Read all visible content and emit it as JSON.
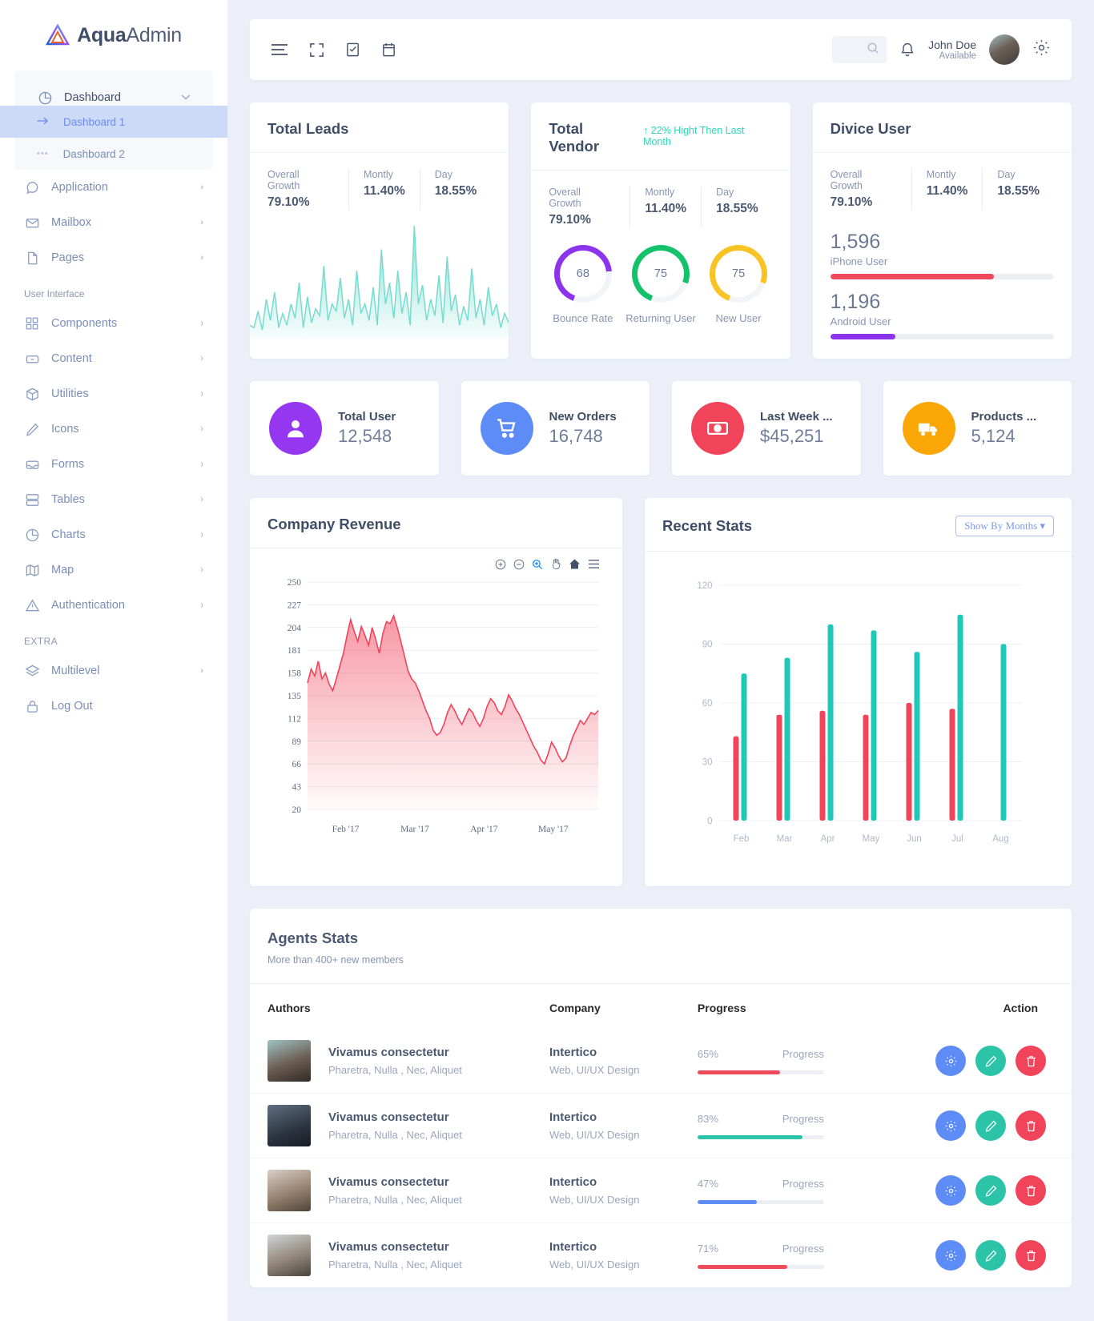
{
  "brand": {
    "strong": "Aqua",
    "light": "Admin",
    "logo_icon": "triangle-logo-icon"
  },
  "sidebar": {
    "dashboard": {
      "label": "Dashboard",
      "icon": "pie-chart-icon",
      "chevron": "chevron-down-icon"
    },
    "sub_items": [
      {
        "label": "Dashboard 1",
        "icon": "arrow-right-icon",
        "active": true
      },
      {
        "label": "Dashboard 2",
        "icon": "dots-icon",
        "active": false
      }
    ],
    "items": [
      {
        "label": "Application",
        "icon": "chat-bubble-icon"
      },
      {
        "label": "Mailbox",
        "icon": "envelope-icon"
      },
      {
        "label": "Pages",
        "icon": "file-icon"
      }
    ],
    "caption_ui": "User Interface",
    "ui_items": [
      {
        "label": "Components",
        "icon": "grid-icon"
      },
      {
        "label": "Content",
        "icon": "drawer-icon"
      },
      {
        "label": "Utilities",
        "icon": "box-icon"
      },
      {
        "label": "Icons",
        "icon": "pencil-icon"
      },
      {
        "label": "Forms",
        "icon": "inbox-icon"
      },
      {
        "label": "Tables",
        "icon": "table-icon"
      },
      {
        "label": "Charts",
        "icon": "pie-chart-icon"
      },
      {
        "label": "Map",
        "icon": "map-icon"
      },
      {
        "label": "Authentication",
        "icon": "warning-triangle-icon"
      }
    ],
    "caption_extra": "EXTRA",
    "extra_items": [
      {
        "label": "Multilevel",
        "icon": "layers-icon",
        "chevron": true
      },
      {
        "label": "Log Out",
        "icon": "lock-icon",
        "chevron": false
      }
    ]
  },
  "topbar": {
    "menu_icon": "hamburger-menu-icon",
    "fullscreen_icon": "fullscreen-icon",
    "task_icon": "checklist-icon",
    "calendar_icon": "calendar-icon",
    "search_placeholder": "",
    "search_icon": "search-icon",
    "bell_icon": "bell-icon",
    "user_name": "John Doe",
    "user_status": "Available",
    "settings_icon": "gear-icon"
  },
  "cards": {
    "total_leads": {
      "title": "Total Leads",
      "metrics": [
        {
          "label": "Overall Growth",
          "value": "79.10%"
        },
        {
          "label": "Montly",
          "value": "11.40%"
        },
        {
          "label": "Day",
          "value": "18.55%"
        }
      ]
    },
    "total_vendor": {
      "title": "Total Vendor",
      "badge": "22% Hight Then Last Month",
      "badge_icon": "arrow-up-icon",
      "badge_color": "#2cd5b5",
      "metrics": [
        {
          "label": "Overall Growth",
          "value": "79.10%"
        },
        {
          "label": "Montly",
          "value": "11.40%"
        },
        {
          "label": "Day",
          "value": "18.55%"
        }
      ],
      "donuts": [
        {
          "value": "68",
          "label": "Bounce Rate",
          "color": "#8c34eb",
          "pct": 68
        },
        {
          "value": "75",
          "label": "Returning User",
          "color": "#13c26b",
          "pct": 75
        },
        {
          "value": "75",
          "label": "New User",
          "color": "#f7c325",
          "pct": 75
        }
      ]
    },
    "device_user": {
      "title": "Divice User",
      "metrics": [
        {
          "label": "Overall Growth",
          "value": "79.10%"
        },
        {
          "label": "Montly",
          "value": "11.40%"
        },
        {
          "label": "Day",
          "value": "18.55%"
        }
      ],
      "devices": [
        {
          "value": "1,596",
          "label": "iPhone User",
          "pct": 73,
          "color": "#ef4a5a"
        },
        {
          "value": "1,196",
          "label": "Android User",
          "pct": 29,
          "color": "#8c34eb"
        }
      ]
    }
  },
  "stats": [
    {
      "label": "Total User",
      "value": "12,548",
      "color": "#9537f0",
      "icon": "user-icon"
    },
    {
      "label": "New Orders",
      "value": "16,748",
      "color": "#5e8cf7",
      "icon": "cart-icon"
    },
    {
      "label": "Last Week ...",
      "value": "$45,251",
      "color": "#f1435a",
      "icon": "money-icon"
    },
    {
      "label": "Products ...",
      "value": "5,124",
      "color": "#f9a606",
      "icon": "truck-icon"
    }
  ],
  "revenue": {
    "title": "Company Revenue",
    "toolbar": [
      "zoom-in-icon",
      "zoom-out-icon",
      "selection-zoom-icon",
      "pan-icon",
      "home-icon",
      "menu-icon"
    ]
  },
  "recent_stats": {
    "title": "Recent Stats",
    "dropdown_label": "Show By  Months",
    "dropdown_icon": "caret-down-icon"
  },
  "agents": {
    "title": "Agents Stats",
    "subtitle": "More than 400+ new members",
    "columns": [
      "Authors",
      "Company",
      "Progress",
      "Action"
    ],
    "rows": [
      {
        "name": "Vivamus consectetur",
        "desc": "Pharetra, Nulla , Nec, Aliquet",
        "company": "Intertico",
        "company_desc": "Web, UI/UX Design",
        "progress": "65%",
        "progress_label": "Progress",
        "pct": 65,
        "color": "#ef4a5a"
      },
      {
        "name": "Vivamus consectetur",
        "desc": "Pharetra, Nulla , Nec, Aliquet",
        "company": "Intertico",
        "company_desc": "Web, UI/UX Design",
        "progress": "83%",
        "progress_label": "Progress",
        "pct": 83,
        "color": "#2cc4a9"
      },
      {
        "name": "Vivamus consectetur",
        "desc": "Pharetra, Nulla , Nec, Aliquet",
        "company": "Intertico",
        "company_desc": "Web, UI/UX Design",
        "progress": "47%",
        "progress_label": "Progress",
        "pct": 47,
        "color": "#5e8cf7"
      },
      {
        "name": "Vivamus consectetur",
        "desc": "Pharetra, Nulla , Nec, Aliquet",
        "company": "Intertico",
        "company_desc": "Web, UI/UX Design",
        "progress": "71%",
        "progress_label": "Progress",
        "pct": 71,
        "color": "#ef4a5a"
      }
    ],
    "action_icons": [
      "gear-icon",
      "pencil-icon",
      "trash-icon"
    ],
    "action_colors": [
      "#5e8cf7",
      "#2cc4a9",
      "#f1435a"
    ]
  },
  "chart_data": [
    {
      "type": "area",
      "name": "total-leads-sparkline",
      "title": "Total Leads",
      "color": "#76dcd0",
      "ylim": [
        0,
        100
      ],
      "values": [
        12,
        10,
        24,
        8,
        34,
        16,
        40,
        10,
        22,
        12,
        30,
        18,
        48,
        10,
        36,
        14,
        26,
        20,
        62,
        16,
        30,
        24,
        52,
        18,
        34,
        12,
        58,
        22,
        30,
        16,
        44,
        12,
        76,
        30,
        48,
        18,
        58,
        22,
        40,
        12,
        96,
        30,
        46,
        16,
        34,
        20,
        54,
        14,
        70,
        24,
        38,
        12,
        28,
        16,
        60,
        18,
        34,
        12,
        44,
        20,
        30,
        10,
        22,
        14
      ]
    },
    {
      "type": "area",
      "name": "company-revenue",
      "title": "Company Revenue",
      "color": "#f1435a",
      "ylabel": "",
      "xlabel": "",
      "yticks": [
        250,
        227,
        204,
        181,
        158,
        135,
        112,
        89,
        66,
        43,
        20
      ],
      "ylim": [
        20,
        250
      ],
      "xticks": [
        "Feb '17",
        "Mar '17",
        "Apr '17",
        "May '17"
      ],
      "grid": true,
      "values": [
        148,
        162,
        155,
        170,
        152,
        158,
        147,
        140,
        152,
        165,
        178,
        196,
        212,
        200,
        190,
        205,
        196,
        186,
        204,
        192,
        178,
        198,
        210,
        208,
        216,
        204,
        190,
        175,
        160,
        152,
        148,
        140,
        130,
        120,
        112,
        100,
        95,
        98,
        106,
        118,
        126,
        120,
        112,
        106,
        114,
        122,
        118,
        110,
        104,
        112,
        124,
        132,
        128,
        120,
        116,
        124,
        136,
        130,
        122,
        116,
        108,
        100,
        92,
        84,
        78,
        70,
        66,
        76,
        88,
        82,
        74,
        68,
        72,
        84,
        94,
        102,
        110,
        106,
        112,
        118,
        116,
        120
      ]
    },
    {
      "type": "bar",
      "name": "recent-stats",
      "title": "Recent Stats",
      "categories": [
        "Feb",
        "Mar",
        "Apr",
        "May",
        "Jun",
        "Jul",
        "Aug"
      ],
      "yticks": [
        0,
        30,
        60,
        90,
        120
      ],
      "ylim": [
        0,
        120
      ],
      "series": [
        {
          "name": "series-1",
          "color": "#f1435a",
          "values": [
            43,
            54,
            56,
            54,
            60,
            57,
            0
          ]
        },
        {
          "name": "series-2",
          "color": "#21c8b7",
          "values": [
            75,
            83,
            100,
            97,
            86,
            105,
            90
          ]
        }
      ]
    }
  ]
}
